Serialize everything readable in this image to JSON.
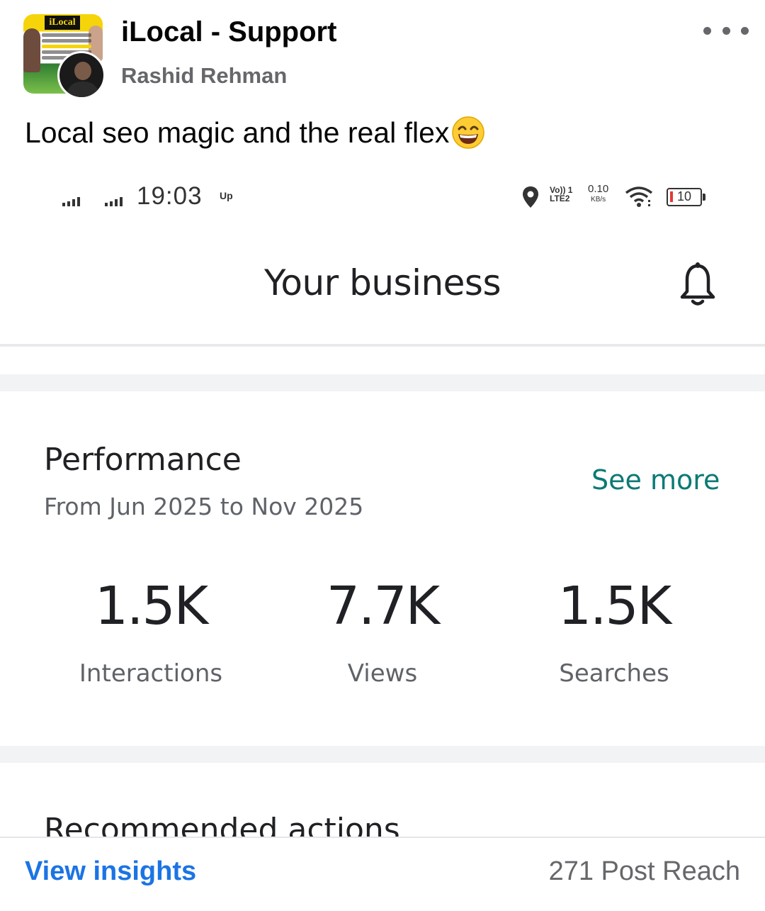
{
  "post": {
    "page_name": "iLocal - Support",
    "author_name": "Rashid Rehman",
    "text": "Local seo magic and the real flex",
    "emoji": "grinning-squinting-face",
    "avatar_brand": "iLocal"
  },
  "screenshot": {
    "status_bar": {
      "time": "19:03",
      "up_indicator": "Up",
      "volte_line1": "Vo)) 1",
      "volte_line2": "LTE2",
      "net_speed": "0.10",
      "net_speed_unit": "KB/s",
      "battery": "10",
      "icons": [
        "signal-icon",
        "location-pin-icon",
        "wifi-icon",
        "battery-icon"
      ]
    },
    "app_bar": {
      "title": "Your business",
      "icon": "bell-icon"
    },
    "performance": {
      "title": "Performance",
      "date_range": "From Jun 2025 to Nov 2025",
      "see_more": "See more",
      "metrics": [
        {
          "value": "1.5K",
          "label": "Interactions"
        },
        {
          "value": "7.7K",
          "label": "Views"
        },
        {
          "value": "1.5K",
          "label": "Searches"
        }
      ]
    },
    "recommended": {
      "title": "Recommended actions"
    }
  },
  "footer": {
    "view_insights": "View insights",
    "post_reach": "271 Post Reach"
  },
  "colors": {
    "link_blue": "#1b74e4",
    "see_more_teal": "#0b7a75",
    "secondary_text": "#65676b"
  }
}
